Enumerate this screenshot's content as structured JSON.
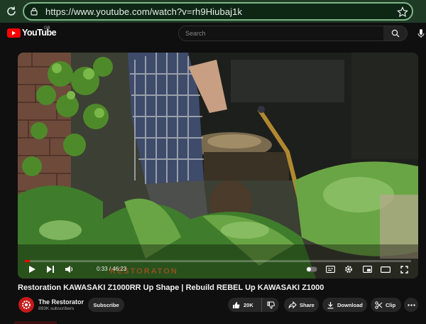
{
  "browser": {
    "url": "https://www.youtube.com/watch?v=rh9Hiubaj1k"
  },
  "header": {
    "logo_text": "YouTube",
    "region": "GB",
    "search_placeholder": "Search"
  },
  "player": {
    "time": "0:33 / 46:23",
    "progress_fraction": 0.012,
    "watermark": "RESTORATON",
    "accent_color": "#ff0000"
  },
  "video": {
    "title": "Restoration KAWASAKI Z1000RR Up Shape | Rebuild REBEL Up KAWASAKI Z1000"
  },
  "channel": {
    "name": "The Restorator",
    "subscribers": "893K subscribers",
    "subscribe_label": "Subscribe"
  },
  "actions": {
    "likes": "20K",
    "share_label": "Share",
    "download_label": "Download",
    "clip_label": "Clip"
  },
  "icons": [
    "reload-icon",
    "lock-icon",
    "star-icon",
    "search-icon",
    "mic-icon",
    "play-icon",
    "next-icon",
    "volume-icon",
    "autoplay-icon",
    "captions-icon",
    "settings-icon",
    "miniplayer-icon",
    "theater-icon",
    "fullscreen-icon",
    "thumbs-up-icon",
    "thumbs-down-icon",
    "share-icon",
    "download-icon",
    "clip-icon",
    "more-icon"
  ]
}
